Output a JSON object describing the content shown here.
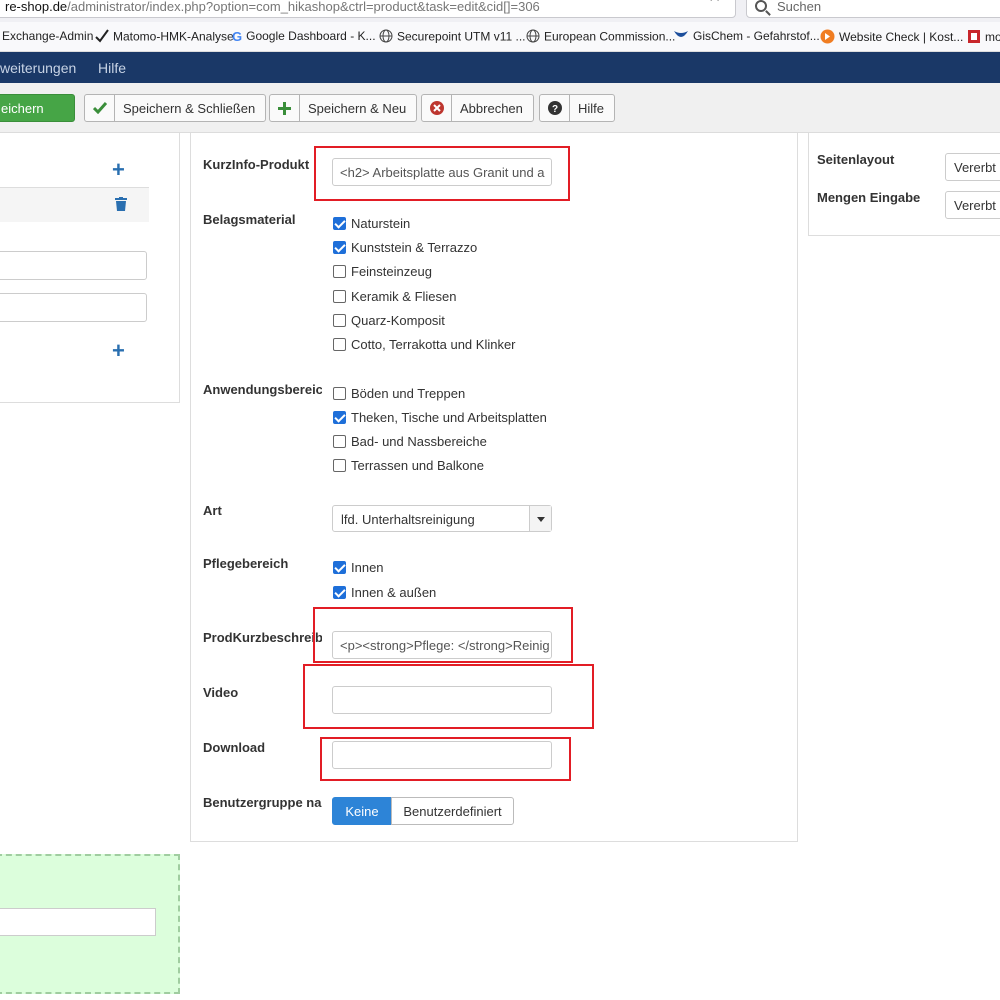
{
  "browser": {
    "url_host": "re-shop.de",
    "url_path": "/administrator/index.php?option=com_hikashop&ctrl=product&task=edit&cid[]=306",
    "search_placeholder": "Suchen",
    "bookmarks": [
      {
        "label": "Exchange-Admin",
        "icon": "none"
      },
      {
        "label": "Matomo-HMK-Analyse",
        "icon": "checkmark-icon"
      },
      {
        "label": "Google Dashboard - K...",
        "icon": "google-icon"
      },
      {
        "label": "Securepoint UTM v11 ...",
        "icon": "globe-icon"
      },
      {
        "label": "European Commission...",
        "icon": "globe-icon"
      },
      {
        "label": "GisChem - Gefahrstof...",
        "icon": "gischem-icon"
      },
      {
        "label": "Website Check | Kost...",
        "icon": "website-check-icon"
      },
      {
        "label": "mo",
        "icon": "mo-icon"
      }
    ]
  },
  "nav": {
    "items": [
      "weiterungen",
      "Hilfe"
    ]
  },
  "toolbar": {
    "save": "eichern",
    "save_close": "Speichern & Schließen",
    "save_new": "Speichern & Neu",
    "cancel": "Abbrechen",
    "help": "Hilfe"
  },
  "form": {
    "kurzinfo": {
      "label": "KurzInfo-Produkt",
      "value": "<h2>  Arbeitsplatte aus Granit und a"
    },
    "belag": {
      "label": "Belagsmaterial",
      "options": [
        {
          "label": "Naturstein",
          "checked": true
        },
        {
          "label": "Kunststein & Terrazzo",
          "checked": true
        },
        {
          "label": "Feinsteinzeug",
          "checked": false
        },
        {
          "label": "Keramik & Fliesen",
          "checked": false
        },
        {
          "label": "Quarz-Komposit",
          "checked": false
        },
        {
          "label": "Cotto, Terrakotta und Klinker",
          "checked": false
        }
      ]
    },
    "anwendung": {
      "label": "Anwendungsbereich",
      "options": [
        {
          "label": "Böden und Treppen",
          "checked": false
        },
        {
          "label": "Theken, Tische und Arbeitsplatten",
          "checked": true
        },
        {
          "label": "Bad- und Nassbereiche",
          "checked": false
        },
        {
          "label": "Terrassen und Balkone",
          "checked": false
        }
      ]
    },
    "art": {
      "label": "Art",
      "value": "lfd. Unterhaltsreinigung"
    },
    "pflege": {
      "label": "Pflegebereich",
      "options": [
        {
          "label": "Innen",
          "checked": true
        },
        {
          "label": "Innen & außen",
          "checked": true
        }
      ]
    },
    "prodkurz": {
      "label": "ProdKurzbeschreibung",
      "value": "<p><strong>Pflege: </strong>Reinig"
    },
    "video": {
      "label": "Video",
      "value": ""
    },
    "download": {
      "label": "Download",
      "value": ""
    },
    "benutzergruppe": {
      "label": "Benutzergruppe na",
      "options": [
        "Keine",
        "Benutzerdefiniert"
      ],
      "selected": "Keine"
    }
  },
  "right": {
    "seitenlayout": {
      "label": "Seitenlayout",
      "value": "Vererbt"
    },
    "mengen": {
      "label": "Mengen Eingabe",
      "value": "Vererbt"
    }
  },
  "colors": {
    "nav": "#1a3867",
    "save_green": "#46a546",
    "highlight_red": "#e21d25",
    "accent_blue": "#2d84d7"
  }
}
